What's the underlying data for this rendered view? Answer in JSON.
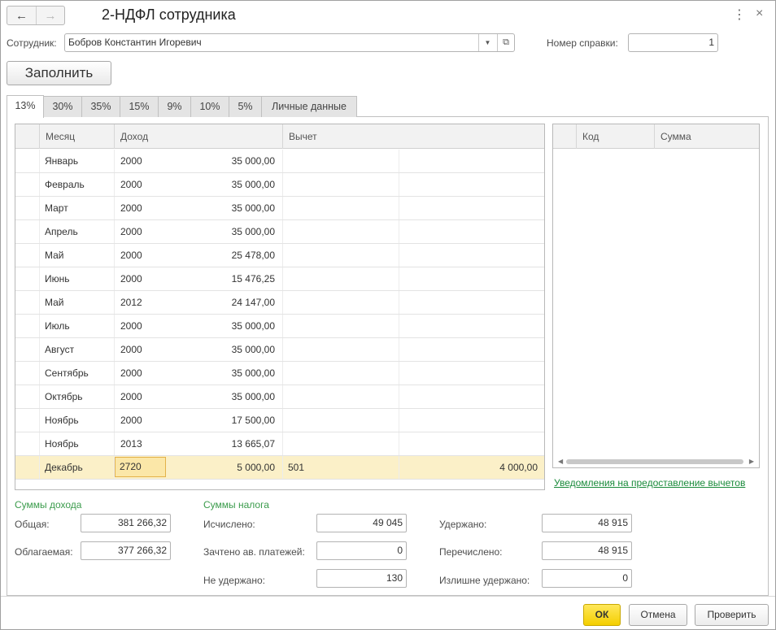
{
  "window": {
    "title": "2-НДФЛ сотрудника"
  },
  "employee": {
    "label": "Сотрудник:",
    "value": "Бобров Константин Игоревич",
    "cert_label": "Номер справки:",
    "cert_value": "1"
  },
  "fill_button": "Заполнить",
  "tabs": [
    {
      "label": "13%",
      "active": true
    },
    {
      "label": "30%"
    },
    {
      "label": "35%"
    },
    {
      "label": "15%"
    },
    {
      "label": "9%"
    },
    {
      "label": "10%"
    },
    {
      "label": "5%"
    },
    {
      "label": "Личные данные"
    }
  ],
  "income_table": {
    "columns": {
      "month": "Месяц",
      "income": "Доход",
      "deduction": "Вычет"
    },
    "rows": [
      {
        "month": "Январь",
        "code": "2000",
        "amount": "35 000,00",
        "ded_code": "",
        "ded_amount": ""
      },
      {
        "month": "Февраль",
        "code": "2000",
        "amount": "35 000,00",
        "ded_code": "",
        "ded_amount": ""
      },
      {
        "month": "Март",
        "code": "2000",
        "amount": "35 000,00",
        "ded_code": "",
        "ded_amount": ""
      },
      {
        "month": "Апрель",
        "code": "2000",
        "amount": "35 000,00",
        "ded_code": "",
        "ded_amount": ""
      },
      {
        "month": "Май",
        "code": "2000",
        "amount": "25 478,00",
        "ded_code": "",
        "ded_amount": ""
      },
      {
        "month": "Июнь",
        "code": "2000",
        "amount": "15 476,25",
        "ded_code": "",
        "ded_amount": ""
      },
      {
        "month": "Май",
        "code": "2012",
        "amount": "24 147,00",
        "ded_code": "",
        "ded_amount": ""
      },
      {
        "month": "Июль",
        "code": "2000",
        "amount": "35 000,00",
        "ded_code": "",
        "ded_amount": ""
      },
      {
        "month": "Август",
        "code": "2000",
        "amount": "35 000,00",
        "ded_code": "",
        "ded_amount": ""
      },
      {
        "month": "Сентябрь",
        "code": "2000",
        "amount": "35 000,00",
        "ded_code": "",
        "ded_amount": ""
      },
      {
        "month": "Октябрь",
        "code": "2000",
        "amount": "35 000,00",
        "ded_code": "",
        "ded_amount": ""
      },
      {
        "month": "Ноябрь",
        "code": "2000",
        "amount": "17 500,00",
        "ded_code": "",
        "ded_amount": ""
      },
      {
        "month": "Ноябрь",
        "code": "2013",
        "amount": "13 665,07",
        "ded_code": "",
        "ded_amount": ""
      },
      {
        "month": "Декабрь",
        "code": "2720",
        "amount": "5 000,00",
        "ded_code": "501",
        "ded_amount": "4 000,00",
        "selected": true
      }
    ]
  },
  "deductions_table": {
    "columns": {
      "code": "Код",
      "sum": "Сумма"
    }
  },
  "notification_link": "Уведомления на предоставление вычетов",
  "income_sums": {
    "title": "Суммы дохода",
    "total_label": "Общая:",
    "total_value": "381 266,32",
    "taxable_label": "Облагаемая:",
    "taxable_value": "377 266,32"
  },
  "tax_sums": {
    "title": "Суммы налога",
    "calculated_label": "Исчислено:",
    "calculated_value": "49 045",
    "advance_label": "Зачтено ав. платежей:",
    "advance_value": "0",
    "not_withheld_label": "Не удержано:",
    "not_withheld_value": "130",
    "withheld_label": "Удержано:",
    "withheld_value": "48 915",
    "transferred_label": "Перечислено:",
    "transferred_value": "48 915",
    "excess_label": "Излишне удержано:",
    "excess_value": "0"
  },
  "buttons": {
    "ok": "ОК",
    "cancel": "Отмена",
    "check": "Проверить"
  },
  "colors": {
    "ok_button": "#f4cf00",
    "selected_row": "#fbf0c8",
    "section_title": "#3a9b4b",
    "link": "#1a8b3b"
  }
}
